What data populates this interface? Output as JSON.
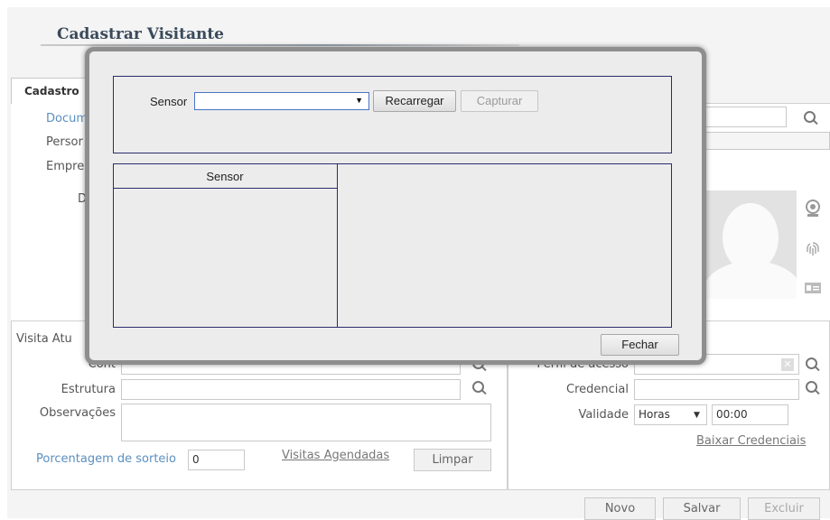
{
  "page": {
    "title": "Cadastrar Visitante"
  },
  "tabs": [
    {
      "label": "Cadastro"
    }
  ],
  "form_left": {
    "document_label": "Docum",
    "person_label": "Persor",
    "company_label": "Empre",
    "d_label": "D"
  },
  "visit": {
    "section_label": "Visita Atu",
    "contact_label": "Cont",
    "structure_label": "Estrutura",
    "notes_label": "Observações",
    "raffle_label": "Porcentagem de sorteio",
    "raffle_value": "0",
    "scheduled_link": "Visitas Agendadas",
    "clear_button": "Limpar"
  },
  "access": {
    "access_label": "Perfil de acesso",
    "credential_label": "Credencial",
    "validity_label": "Validade",
    "validity_unit": "Horas",
    "validity_time": "00:00",
    "download_link": "Baixar Credenciais"
  },
  "footer": {
    "new_button": "Novo",
    "save_button": "Salvar",
    "delete_button": "Excluir"
  },
  "modal": {
    "sensor_label": "Sensor",
    "sensor_value": "",
    "reload_button": "Recarregar",
    "capture_button": "Capturar",
    "table_header": "Sensor",
    "close_button": "Fechar"
  },
  "icons": [
    "search-icon",
    "webcam-icon",
    "fingerprint-icon",
    "id-card-icon",
    "clear-icon"
  ]
}
